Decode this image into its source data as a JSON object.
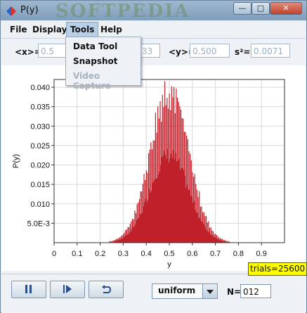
{
  "window": {
    "title": "P(y)",
    "watermark": "SOFTPEDIA",
    "buttons": {
      "minimize": "—",
      "maximize": "□",
      "close": "✕"
    }
  },
  "menu": {
    "items": [
      "File",
      "Display",
      "Tools",
      "Help"
    ],
    "open_menu": "Tools",
    "dropdown": [
      {
        "label": "Data Tool",
        "enabled": true
      },
      {
        "label": "Snapshot",
        "enabled": true
      },
      {
        "label": "Video Capture",
        "enabled": false
      }
    ]
  },
  "stats": {
    "mean_x": {
      "label": "<x>=",
      "value": "0.5"
    },
    "second_field": {
      "value": "33"
    },
    "mean_y": {
      "label": "<y>=",
      "value": "0.500"
    },
    "variance": {
      "label": "s²=",
      "value": "0.0071"
    }
  },
  "chart_data": {
    "type": "bar",
    "title": "",
    "xlabel": "y",
    "ylabel": "P(y)",
    "xlim": [
      0,
      1.0
    ],
    "ylim": [
      0,
      0.042
    ],
    "x_ticks": [
      "0",
      "0.1",
      "0.2",
      "0.3",
      "0.4",
      "0.5",
      "0.6",
      "0.7",
      "0.8",
      "0.9"
    ],
    "y_ticks": [
      "5.0E-3",
      "0.010",
      "0.015",
      "0.020",
      "0.025",
      "0.030",
      "0.035",
      "0.040"
    ],
    "y_tick_values": [
      0.005,
      0.01,
      0.015,
      0.02,
      0.025,
      0.03,
      0.035,
      0.04
    ],
    "grid": true,
    "bar_color": "#c0202a",
    "distribution": {
      "mean": 0.5,
      "std": 0.0833,
      "peak": 0.041,
      "bin_width": 0.0025
    }
  },
  "status": {
    "trials": "trials=25600"
  },
  "controls": {
    "buttons": [
      "pause",
      "step",
      "reset"
    ],
    "distribution": "uniform",
    "n_label": "N=",
    "n_value": "012"
  }
}
